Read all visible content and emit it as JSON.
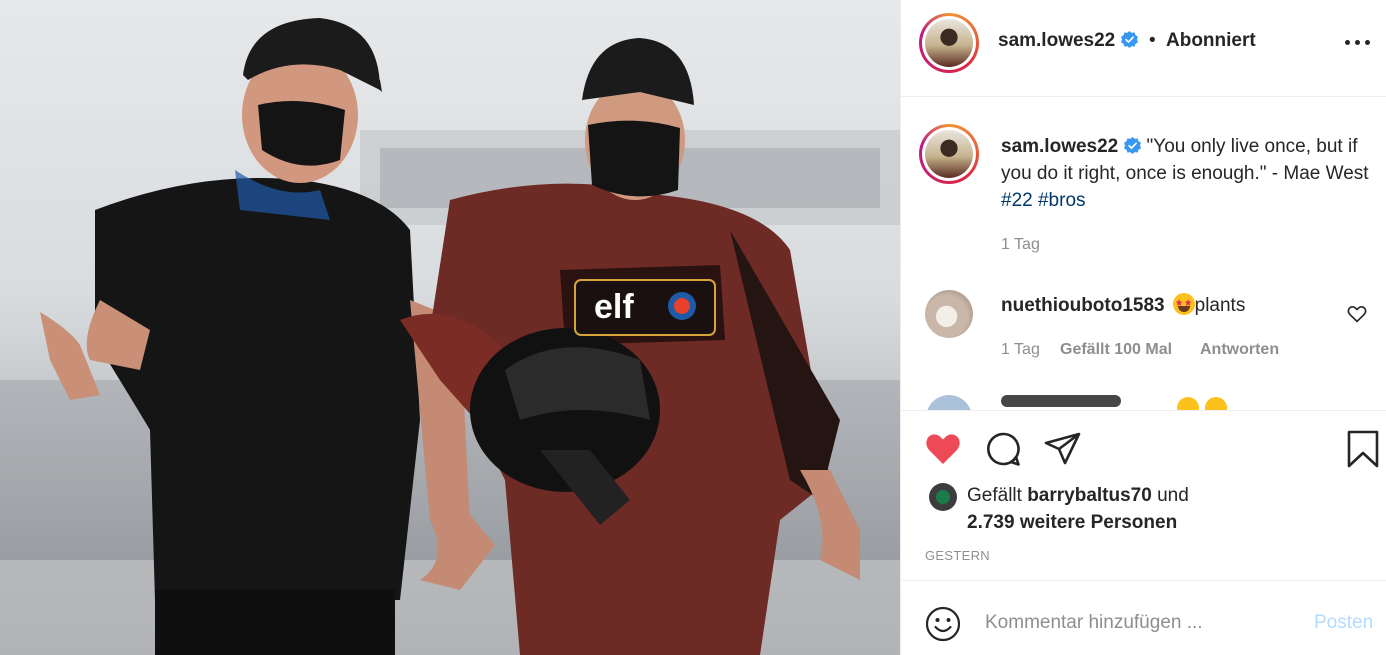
{
  "post": {
    "username": "sam.lowes22",
    "separator": "•",
    "follow_status": "Abonniert"
  },
  "caption": {
    "username": "sam.lowes22",
    "text": "\"You only live once, but if you do it right, once is enough.\" - Mae West",
    "hashtags": [
      "#22",
      "#bros"
    ],
    "time": "1 Tag"
  },
  "comments": [
    {
      "username": "nuethiouboto1583",
      "text": "plants",
      "time": "1 Tag",
      "likes": "Gefällt 100 Mal",
      "reply": "Antworten"
    }
  ],
  "likes": {
    "prefix": "Gefällt",
    "user": "barrybaltus70",
    "conjunction": "und",
    "others": "2.739 weitere Personen"
  },
  "date": "GESTERN",
  "composer": {
    "placeholder": "Kommentar hinzufügen ...",
    "post_label": "Posten"
  },
  "photo": {
    "sponsor_text": "elf"
  },
  "icons": {
    "like": "heart-filled-icon",
    "comment": "comment-icon",
    "share": "share-icon",
    "save": "bookmark-icon",
    "more": "more-options-icon",
    "emoji": "emoji-icon",
    "verified": "verified-badge-icon"
  },
  "colors": {
    "like_red": "#ed4956",
    "verified_blue": "#3897f0",
    "link_blue": "#00376b",
    "post_disabled": "#b3dbff"
  }
}
